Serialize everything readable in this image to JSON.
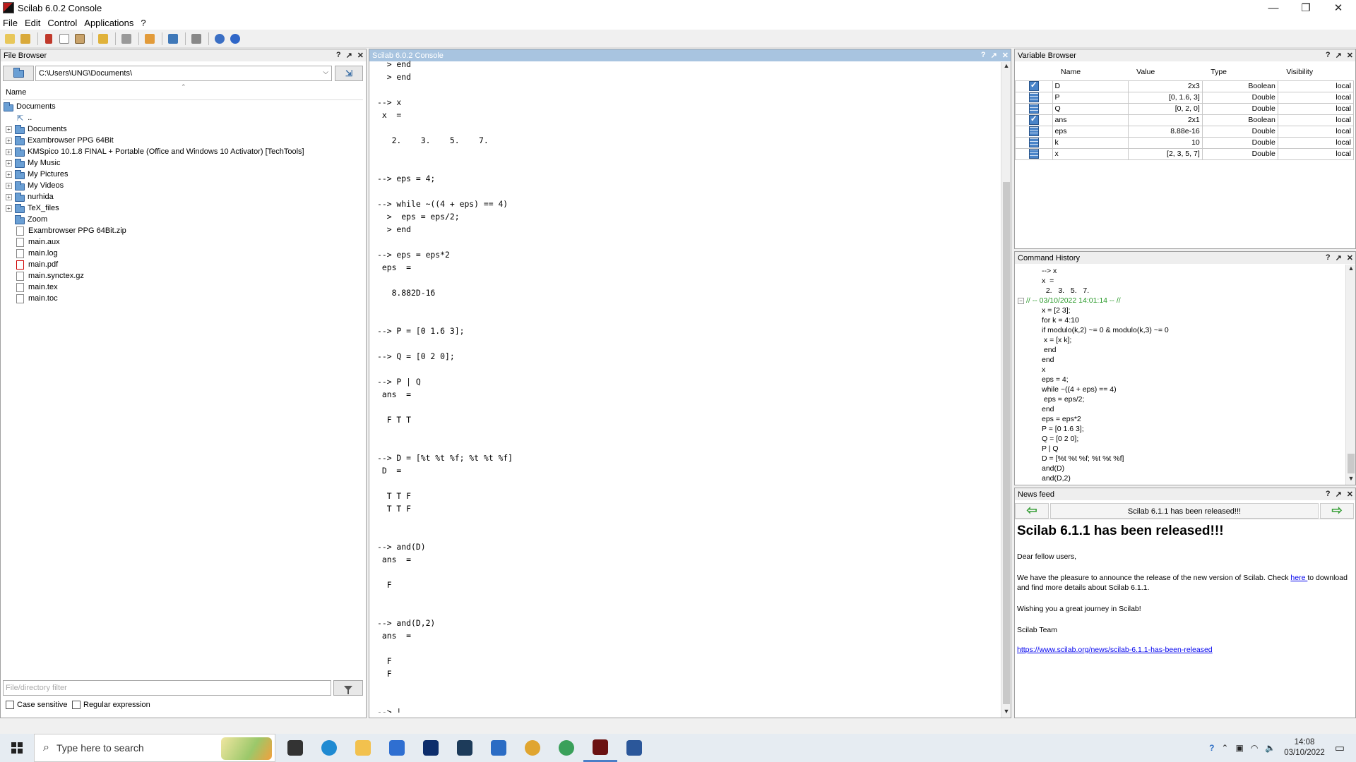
{
  "window": {
    "title": "Scilab 6.0.2 Console",
    "minimize": "—",
    "maximize": "❐",
    "close": "✕"
  },
  "menu": [
    "File",
    "Edit",
    "Control",
    "Applications",
    "?"
  ],
  "file_browser": {
    "title": "File Browser",
    "path": "C:\\Users\\UNG\\Documents\\",
    "column": "Name",
    "root": "Documents",
    "items": [
      {
        "name": "..",
        "kind": "up"
      },
      {
        "name": "Documents",
        "kind": "folder"
      },
      {
        "name": "Exambrowser PPG 64Bit",
        "kind": "folder"
      },
      {
        "name": "KMSpico 10.1.8 FINAL + Portable (Office and Windows 10 Activator) [TechTools]",
        "kind": "folder"
      },
      {
        "name": "My Music",
        "kind": "folder"
      },
      {
        "name": "My Pictures",
        "kind": "folder"
      },
      {
        "name": "My Videos",
        "kind": "folder"
      },
      {
        "name": "nurhida",
        "kind": "folder"
      },
      {
        "name": "TeX_files",
        "kind": "folder"
      },
      {
        "name": "Zoom",
        "kind": "folder-noexp"
      },
      {
        "name": "Exambrowser PPG 64Bit.zip",
        "kind": "file"
      },
      {
        "name": "main.aux",
        "kind": "file"
      },
      {
        "name": "main.log",
        "kind": "file"
      },
      {
        "name": "main.pdf",
        "kind": "pdf"
      },
      {
        "name": "main.synctex.gz",
        "kind": "file"
      },
      {
        "name": "main.tex",
        "kind": "file"
      },
      {
        "name": "main.toc",
        "kind": "file"
      }
    ],
    "filter_placeholder": "File/directory filter",
    "case_sensitive": "Case sensitive",
    "regex": "Regular expression"
  },
  "console": {
    "title": "Scilab 6.0.2 Console",
    "lines": [
      "  > end",
      "  > end",
      "",
      "--> x",
      " x  =",
      "",
      "   2.    3.    5.    7.",
      "",
      "",
      "--> eps = 4;",
      "",
      "--> while ~((4 + eps) == 4)",
      "  >  eps = eps/2;",
      "  > end",
      "",
      "--> eps = eps*2",
      " eps  =",
      "",
      "   8.882D-16",
      "",
      "",
      "--> P = [0 1.6 3];",
      "",
      "--> Q = [0 2 0];",
      "",
      "--> P | Q",
      " ans  =",
      "",
      "  F T T",
      "",
      "",
      "--> D = [%t %t %f; %t %t %f]",
      " D  =",
      "",
      "  T T F",
      "  T T F",
      "",
      "",
      "--> and(D)",
      " ans  =",
      "",
      "  F",
      "",
      "",
      "--> and(D,2)",
      " ans  =",
      "",
      "  F",
      "  F",
      "",
      "",
      "--> |"
    ]
  },
  "variable_browser": {
    "title": "Variable Browser",
    "columns": [
      "Name",
      "Value",
      "Type",
      "Visibility"
    ],
    "rows": [
      {
        "name": "D",
        "value": "2x3",
        "type": "Boolean",
        "visibility": "local",
        "icon": "boolean"
      },
      {
        "name": "P",
        "value": "[0, 1.6, 3]",
        "type": "Double",
        "visibility": "local",
        "icon": "double"
      },
      {
        "name": "Q",
        "value": "[0, 2, 0]",
        "type": "Double",
        "visibility": "local",
        "icon": "double"
      },
      {
        "name": "ans",
        "value": "2x1",
        "type": "Boolean",
        "visibility": "local",
        "icon": "boolean"
      },
      {
        "name": "eps",
        "value": "8.88e-16",
        "type": "Double",
        "visibility": "local",
        "icon": "double"
      },
      {
        "name": "k",
        "value": "10",
        "type": "Double",
        "visibility": "local",
        "icon": "double"
      },
      {
        "name": "x",
        "value": "[2, 3, 5, 7]",
        "type": "Double",
        "visibility": "local",
        "icon": "double"
      }
    ]
  },
  "command_history": {
    "title": "Command History",
    "lines": [
      {
        "text": "--> x",
        "indent": 1
      },
      {
        "text": "x  =",
        "indent": 1
      },
      {
        "text": "  2.   3.   5.   7.",
        "indent": 1
      },
      {
        "text": "// -- 03/10/2022 14:01:14 -- //",
        "indent": 0,
        "session": true
      },
      {
        "text": "x = [2 3];",
        "indent": 1
      },
      {
        "text": "for k = 4:10",
        "indent": 1
      },
      {
        "text": "if modulo(k,2) ~= 0 & modulo(k,3) ~= 0",
        "indent": 1
      },
      {
        "text": " x = [x k];",
        "indent": 1
      },
      {
        "text": " end",
        "indent": 1
      },
      {
        "text": "end",
        "indent": 1
      },
      {
        "text": "x",
        "indent": 1
      },
      {
        "text": "eps = 4;",
        "indent": 1
      },
      {
        "text": "while ~((4 + eps) == 4)",
        "indent": 1
      },
      {
        "text": " eps = eps/2;",
        "indent": 1
      },
      {
        "text": "end",
        "indent": 1
      },
      {
        "text": "eps = eps*2",
        "indent": 1
      },
      {
        "text": "P = [0 1.6 3];",
        "indent": 1
      },
      {
        "text": "Q = [0 2 0];",
        "indent": 1
      },
      {
        "text": "P | Q",
        "indent": 1
      },
      {
        "text": "D = [%t %t %f; %t %t %f]",
        "indent": 1
      },
      {
        "text": "and(D)",
        "indent": 1
      },
      {
        "text": "and(D,2)",
        "indent": 1
      }
    ]
  },
  "news_feed": {
    "title": "News feed",
    "headline_bar": "Scilab 6.1.1 has been released!!!",
    "heading": "Scilab 6.1.1 has been released!!!",
    "greeting": "Dear fellow users,",
    "body_before": "We have the pleasure to announce the release of the new version of Scilab. Check ",
    "link_here": "here ",
    "body_after": "to download and find more details about Scilab 6.1.1.",
    "wish": "Wishing you a great journey in Scilab!",
    "signature": "Scilab Team",
    "url": "https://www.scilab.org/news/scilab-6.1.1-has-been-released"
  },
  "taskbar": {
    "search_placeholder": "Type here to search",
    "time": "14:08",
    "date": "03/10/2022",
    "apps": [
      {
        "name": "task-view",
        "color": "#333333"
      },
      {
        "name": "edge",
        "color": "#1f8ad2"
      },
      {
        "name": "file-explorer",
        "color": "#f2c14e"
      },
      {
        "name": "store",
        "color": "#2f6fd1"
      },
      {
        "name": "dropbox",
        "color": "#0d2d6b"
      },
      {
        "name": "powershell-app",
        "color": "#1d3b5a"
      },
      {
        "name": "mail",
        "color": "#2b6cc4"
      },
      {
        "name": "chrome-1",
        "color": "#e0a530"
      },
      {
        "name": "chrome-2",
        "color": "#3aa05a"
      },
      {
        "name": "scilab",
        "color": "#6b1212"
      },
      {
        "name": "word",
        "color": "#2b579a"
      }
    ]
  }
}
